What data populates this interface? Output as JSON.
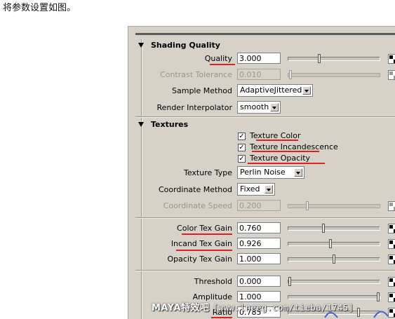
{
  "caption": "将参数设置如图。",
  "shading_quality": {
    "title": "Shading Quality",
    "quality": {
      "label": "Quality",
      "value": "3.000",
      "level": 0.33
    },
    "contrast_tolerance": {
      "label": "Contrast Tolerance",
      "value": "0.010",
      "level": 0.01
    },
    "sample_method": {
      "label": "Sample Method",
      "value": "AdaptiveJittered"
    },
    "render_interpolator": {
      "label": "Render Interpolator",
      "value": "smooth"
    }
  },
  "textures": {
    "title": "Textures",
    "checkboxes": [
      {
        "label": "Texture Color",
        "checked": true
      },
      {
        "label": "Texture Incandescence",
        "checked": true
      },
      {
        "label": "Texture Opacity",
        "checked": true
      }
    ],
    "texture_type": {
      "label": "Texture Type",
      "value": "Perlin Noise"
    },
    "coordinate_method": {
      "label": "Coordinate Method",
      "value": "Fixed"
    },
    "coordinate_speed": {
      "label": "Coordinate Speed",
      "value": "0.200",
      "level": 0.2
    },
    "color_tex_gain": {
      "label": "Color Tex Gain",
      "value": "0.760",
      "level": 0.38
    },
    "incand_tex_gain": {
      "label": "Incand Tex Gain",
      "value": "0.926",
      "level": 0.46
    },
    "opacity_tex_gain": {
      "label": "Opacity Tex Gain",
      "value": "1.000",
      "level": 0.5
    },
    "threshold": {
      "label": "Threshold",
      "value": "0.000",
      "level": 0.0
    },
    "amplitude": {
      "label": "Amplitude",
      "value": "1.000",
      "level": 1.0
    },
    "ratio": {
      "label": "Ratio",
      "value": "0.785",
      "level": 0.78
    }
  },
  "watermark": {
    "brand": "MAYA特效吧",
    "url": "[www.lneeg.com/tieba/1745]"
  },
  "colors": {
    "panel_bg": "#d6d2ca",
    "underline_red": "#e02020",
    "check_mark": "#000000"
  }
}
